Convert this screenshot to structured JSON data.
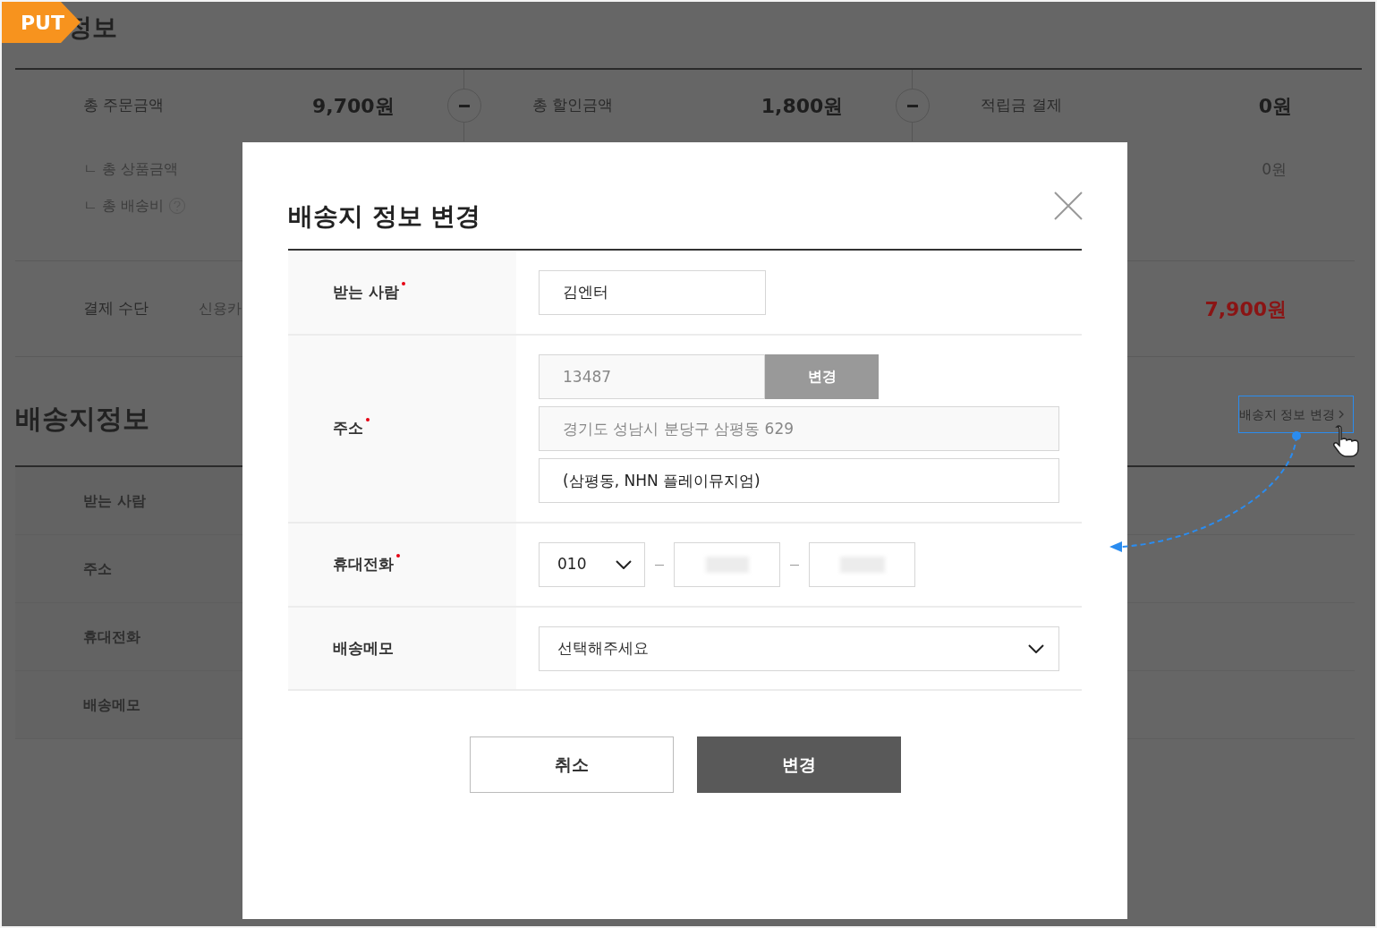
{
  "badge": "PUT",
  "page_heading": "정보",
  "summary": [
    {
      "label": "총 주문금액",
      "amount": "9,700원",
      "operator": true
    },
    {
      "label": "총 할인금액",
      "amount": "1,800원",
      "operator": true
    },
    {
      "label": "적립금 결제",
      "amount": "0원",
      "operator": false
    }
  ],
  "sub_items": [
    {
      "prefix": "ㄴ",
      "label": "총 상품금액",
      "help": false
    },
    {
      "prefix": "ㄴ",
      "label": "총 배송비",
      "help": true
    }
  ],
  "points_sub": "0원",
  "payment": {
    "label": "결제 수단",
    "method": "신용카",
    "total": "7,900원"
  },
  "shipping": {
    "heading": "배송지정보",
    "link": "배송지 정보 변경",
    "rows": [
      "받는 사람",
      "주소",
      "휴대전화",
      "배송메모"
    ]
  },
  "modal": {
    "title": "배송지 정보 변경",
    "fields": [
      {
        "kind": "text",
        "label": "받는 사람",
        "required": true,
        "value": "김엔터"
      },
      {
        "kind": "address",
        "label": "주소",
        "required": true,
        "zip": "13487",
        "button": "변경",
        "address1": "경기도 성남시 분당구 삼평동 629",
        "address2": "(삼평동, NHN 플레이뮤지엄)"
      },
      {
        "kind": "phone",
        "label": "휴대전화",
        "required": true,
        "prefix": "010"
      },
      {
        "kind": "select",
        "label": "배송메모",
        "required": false,
        "placeholder": "선택해주세요"
      }
    ],
    "buttons": [
      {
        "label": "취소",
        "kind": "secondary"
      },
      {
        "label": "변경",
        "kind": "primary"
      }
    ]
  }
}
